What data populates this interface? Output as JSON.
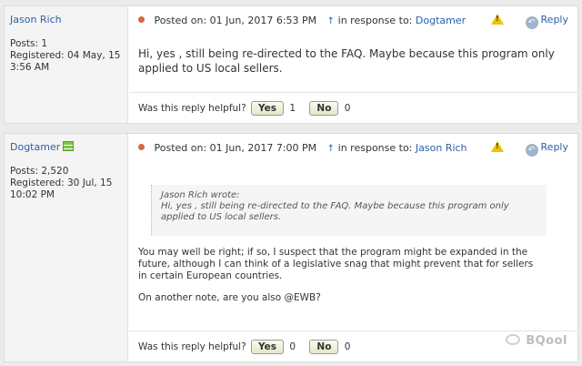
{
  "posts": [
    {
      "author": {
        "name": "Jason Rich",
        "posts": "Posts: 1",
        "registered_label": "Registered: 04 May, 15",
        "registered_time": "3:56 AM"
      },
      "meta": {
        "posted_on": "Posted on: 01 Jun, 2017 6:53 PM",
        "in_response_label": "in response to:",
        "in_response_to": "Dogtamer"
      },
      "body": "Hi, yes , still being re-directed to the FAQ. Maybe because this program only applied to US local sellers.",
      "helpful": {
        "label": "Was this reply helpful?",
        "yes": "Yes",
        "yes_count": "1",
        "no": "No",
        "no_count": "0"
      },
      "reply": "Reply"
    },
    {
      "author": {
        "name": "Dogtamer",
        "posts": "Posts: 2,520",
        "registered_label": "Registered: 30 Jul, 15",
        "registered_time": "10:02 PM"
      },
      "meta": {
        "posted_on": "Posted on: 01 Jun, 2017 7:00 PM",
        "in_response_label": "in response to:",
        "in_response_to": "Jason Rich"
      },
      "quote": {
        "author_line": "Jason Rich wrote:",
        "text": "Hi, yes , still being re-directed to the FAQ. Maybe because this program only applied to US local sellers."
      },
      "body_paragraphs": [
        "You may well be right; if so, I suspect that the program might be expanded in the future, although I can think of a legislative snag that might prevent that for sellers in certain European countries.",
        "On another note, are you also @EWB?"
      ],
      "helpful": {
        "label": "Was this reply helpful?",
        "yes": "Yes",
        "yes_count": "0",
        "no": "No",
        "no_count": "0"
      },
      "reply": "Reply"
    }
  ],
  "watermark": "BQool",
  "icons": {
    "status_dot": "orange-dot-icon",
    "in_response": "reply-arrow-icon",
    "report": "warning-icon",
    "reply": "reply-icon",
    "rank": "rank-bars-icon",
    "watermark_logo": "wechat-icon"
  },
  "colors": {
    "link": "#2b5fa8",
    "dot": "#d9673a",
    "warning": "#f2c200",
    "rank": "#7ec542"
  }
}
